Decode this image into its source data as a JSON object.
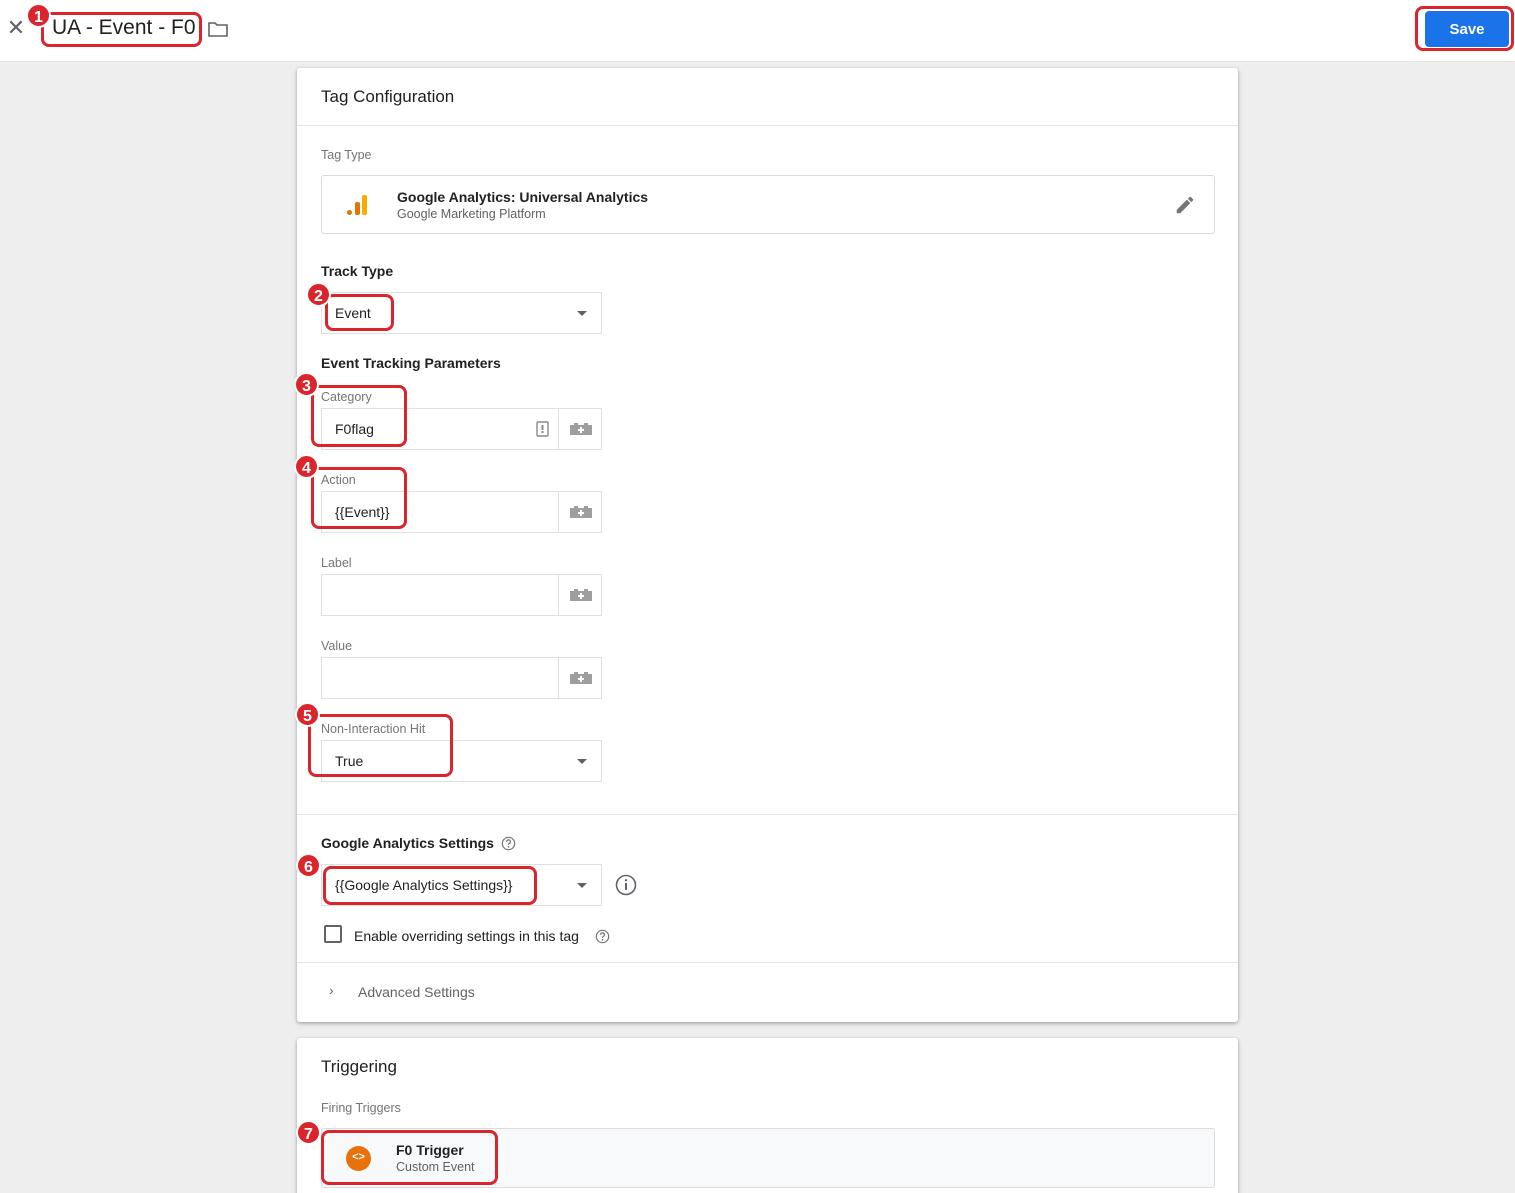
{
  "header": {
    "tag_name": "UA - Event - F0",
    "save_label": "Save",
    "close_icon": "close-icon",
    "folder_icon": "folder-icon"
  },
  "tag_configuration": {
    "title": "Tag Configuration",
    "tag_type_label": "Tag Type",
    "tag_type": {
      "name": "Google Analytics: Universal Analytics",
      "provider": "Google Marketing Platform",
      "icon": "google-analytics-icon",
      "edit_icon": "pencil-icon"
    },
    "track_type": {
      "label": "Track Type",
      "value": "Event"
    },
    "event_tracking": {
      "label": "Event Tracking Parameters",
      "category": {
        "label": "Category",
        "value": "F0flag"
      },
      "action": {
        "label": "Action",
        "value": "{{Event}}"
      },
      "label_field": {
        "label": "Label",
        "value": ""
      },
      "value_field": {
        "label": "Value",
        "value": ""
      }
    },
    "non_interaction": {
      "label": "Non-Interaction Hit",
      "value": "True"
    },
    "ga_settings": {
      "label": "Google Analytics Settings",
      "value": "{{Google Analytics Settings}}"
    },
    "override_checkbox": {
      "label": "Enable overriding settings in this tag",
      "checked": false
    },
    "advanced": {
      "label": "Advanced Settings"
    }
  },
  "triggering": {
    "title": "Triggering",
    "firing_label": "Firing Triggers",
    "trigger": {
      "name": "F0 Trigger",
      "type": "Custom Event",
      "icon": "custom-event-icon"
    }
  },
  "annotations": [
    "1",
    "2",
    "3",
    "4",
    "5",
    "6",
    "7"
  ],
  "colors": {
    "accent": "#1a73e8",
    "highlight": "#d9252b",
    "trigger": "#e8710a"
  }
}
